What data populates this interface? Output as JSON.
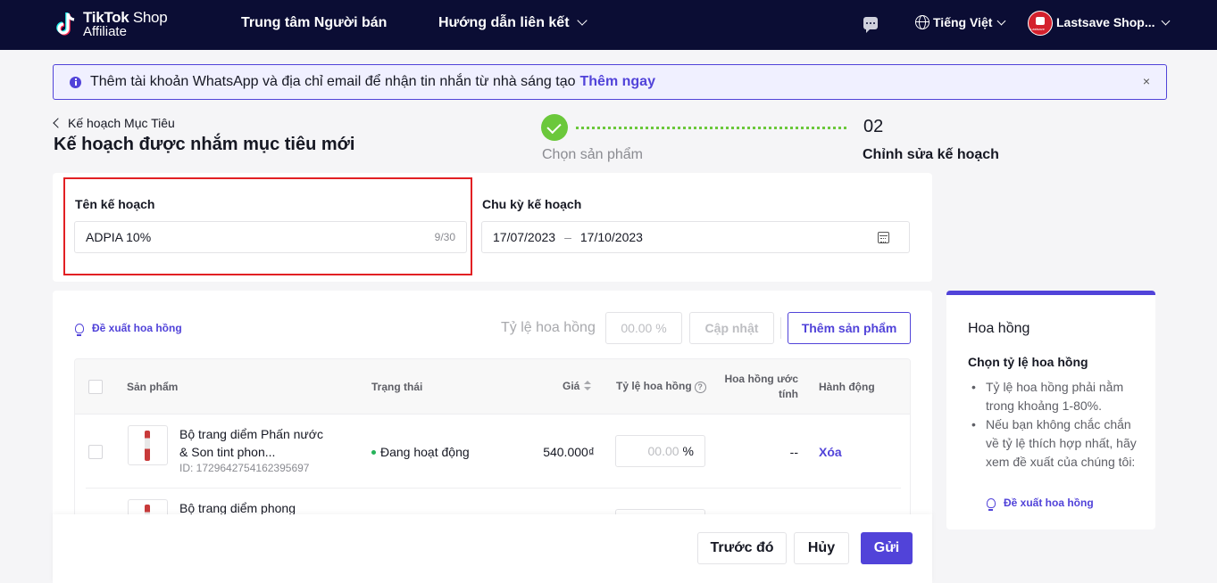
{
  "nav": {
    "logo_brand": "TikTok",
    "logo_shop": "Shop",
    "logo_sub": "Affiliate",
    "seller_center": "Trung tâm Người bán",
    "link_guide": "Hướng dẫn liên kết",
    "language": "Tiếng Việt",
    "shop_name": "Lastsave Shop..."
  },
  "banner": {
    "text": "Thêm tài khoản WhatsApp và địa chỉ email để nhận tin nhắn từ nhà sáng tạo",
    "link": "Thêm ngay",
    "close": "×"
  },
  "header": {
    "back": "Kế hoạch Mục Tiêu",
    "title": "Kế hoạch được nhắm mục tiêu mới"
  },
  "stepper": {
    "step2_num": "02",
    "step1_label": "Chọn sản phẩm",
    "step2_label": "Chỉnh sửa kế hoạch"
  },
  "plan": {
    "name_label": "Tên kế hoạch",
    "name_value": "ADPIA 10%",
    "name_counter": "9/30",
    "period_label": "Chu kỳ kế hoạch",
    "date_start": "17/07/2023",
    "date_sep": "–",
    "date_end": "17/10/2023"
  },
  "toolbar": {
    "suggest": "Đề xuất hoa hồng",
    "rate_label": "Tỷ lệ hoa hồng",
    "rate_placeholder": "00.00 %",
    "update": "Cập nhật",
    "add_product": "Thêm sản phẩm"
  },
  "table": {
    "headers": {
      "product": "Sản phẩm",
      "status": "Trạng thái",
      "price": "Giá",
      "rate": "Tỷ lệ hoa hồng",
      "estimate_line1": "Hoa hồng ước",
      "estimate_line2": "tính",
      "action": "Hành động"
    },
    "rows": [
      {
        "name": "Bộ trang diểm Phấn nước & Son tint phon...",
        "id": "ID: 1729642754162395697",
        "status": "Đang hoạt động",
        "price": "540.000₫",
        "rate_placeholder": "00.00",
        "rate_unit": "%",
        "estimate": "--",
        "action": "Xóa"
      },
      {
        "name": "Bộ trang diểm phong"
      }
    ]
  },
  "footer": {
    "prev": "Trước đó",
    "cancel": "Hủy",
    "submit": "Gửi"
  },
  "sidebar": {
    "title": "Hoa hồng",
    "subtitle": "Chọn tỷ lệ hoa hồng",
    "items": [
      "Tỷ lệ hoa hồng phải nằm trong khoảng 1-80%.",
      "Nếu bạn không chắc chắn về tỷ lệ thích hợp nhất, hãy xem đề xuất của chúng tôi:"
    ],
    "suggest": "Đề xuất hoa hồng"
  },
  "colors": {
    "nav_bg": "#0b0d34",
    "accent": "#5143d9",
    "success": "#6bc83b",
    "highlight": "#e22023"
  }
}
